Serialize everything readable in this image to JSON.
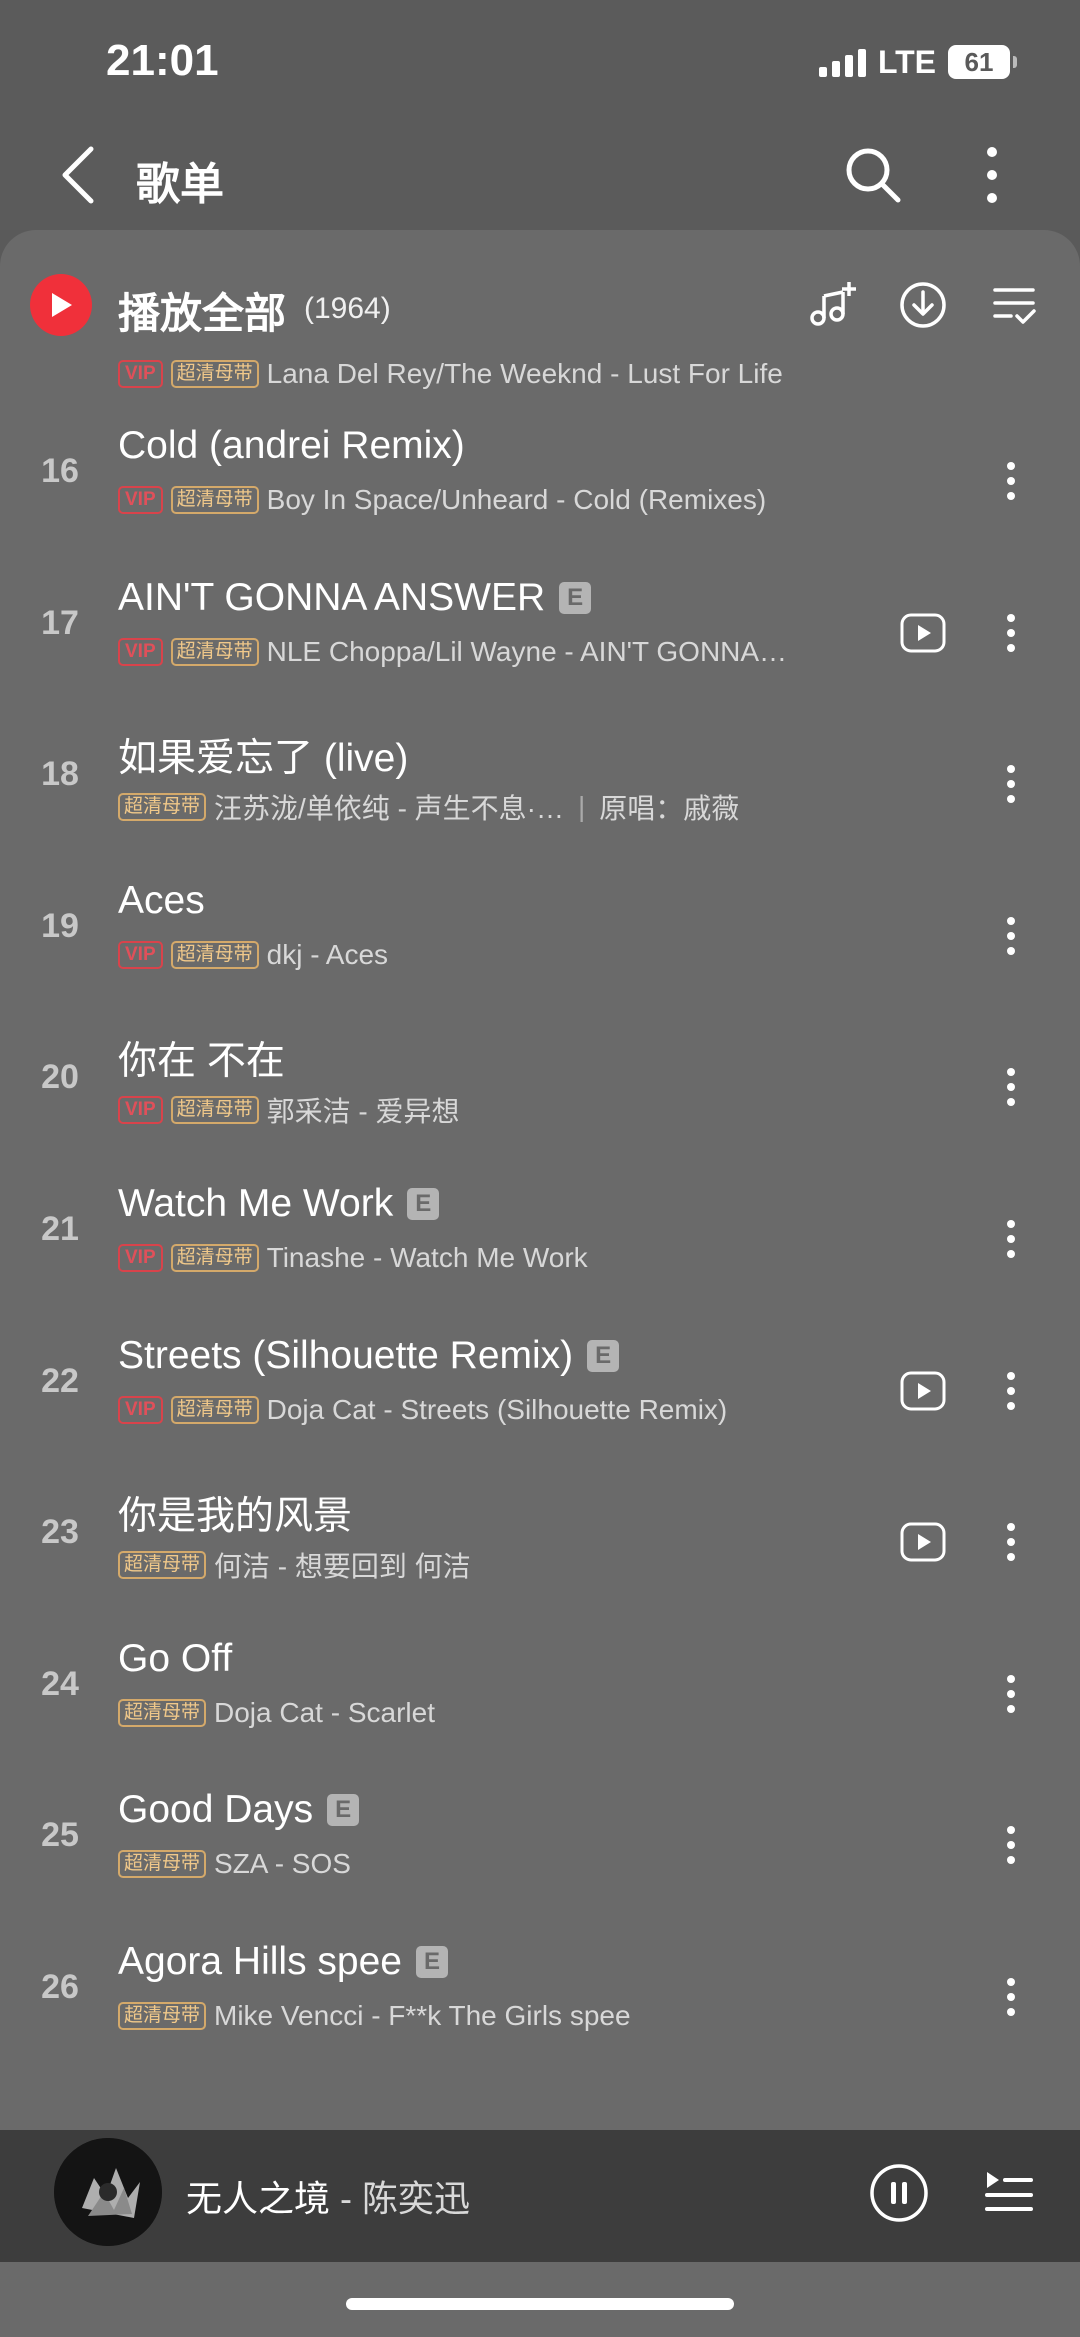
{
  "status_bar": {
    "time": "21:01",
    "network": "LTE",
    "battery": "61"
  },
  "nav": {
    "title": "歌单"
  },
  "play_all": {
    "label": "播放全部",
    "count": "(1964)"
  },
  "partial_row": {
    "vip": "VIP",
    "quality": "超清母带",
    "subtitle": "Lana Del Rey/The Weeknd - Lust For Life"
  },
  "songs": [
    {
      "index": "16",
      "title": "Cold (andrei Remix)",
      "vip": "VIP",
      "quality": "超清母带",
      "subtitle": "Boy In Space/Unheard - Cold (Remixes)"
    },
    {
      "index": "17",
      "title": "AIN'T GONNA ANSWER",
      "explicit": "E",
      "vip": "VIP",
      "quality": "超清母带",
      "subtitle": "NLE Choppa/Lil Wayne - AIN'T GONNA…"
    },
    {
      "index": "18",
      "title": "如果爱忘了 (live)",
      "quality": "超清母带",
      "subtitle": "汪苏泷/单依纯 - 声生不息·…",
      "original": "原唱：戚薇"
    },
    {
      "index": "19",
      "title": "Aces",
      "vip": "VIP",
      "quality": "超清母带",
      "subtitle": "dkj - Aces"
    },
    {
      "index": "20",
      "title": "你在 不在",
      "vip": "VIP",
      "quality": "超清母带",
      "subtitle": "郭采洁 - 爱异想"
    },
    {
      "index": "21",
      "title": "Watch Me Work",
      "explicit": "E",
      "vip": "VIP",
      "quality": "超清母带",
      "subtitle": "Tinashe - Watch Me Work"
    },
    {
      "index": "22",
      "title": "Streets (Silhouette Remix)",
      "explicit": "E",
      "vip": "VIP",
      "quality": "超清母带",
      "subtitle": "Doja Cat - Streets (Silhouette Remix)"
    },
    {
      "index": "23",
      "title": "你是我的风景",
      "quality": "超清母带",
      "subtitle": "何洁 - 想要回到 何洁"
    },
    {
      "index": "24",
      "title": "Go Off",
      "quality": "超清母带",
      "subtitle": "Doja Cat - Scarlet"
    },
    {
      "index": "25",
      "title": "Good Days",
      "explicit": "E",
      "quality": "超清母带",
      "subtitle": "SZA - SOS"
    },
    {
      "index": "26",
      "title": "Agora Hills spee",
      "explicit": "E",
      "quality": "超清母带",
      "subtitle": "Mike Vencci - F**k The Girls spee"
    }
  ],
  "mini_player": {
    "title": "无人之境",
    "separator": " - ",
    "artist": "陈奕迅"
  },
  "colors": {
    "accent_red": "#f0303a",
    "vip_red": "#d9434b",
    "hd_gold": "#d4a96a",
    "sheet_bg": "#6a6a6a"
  }
}
